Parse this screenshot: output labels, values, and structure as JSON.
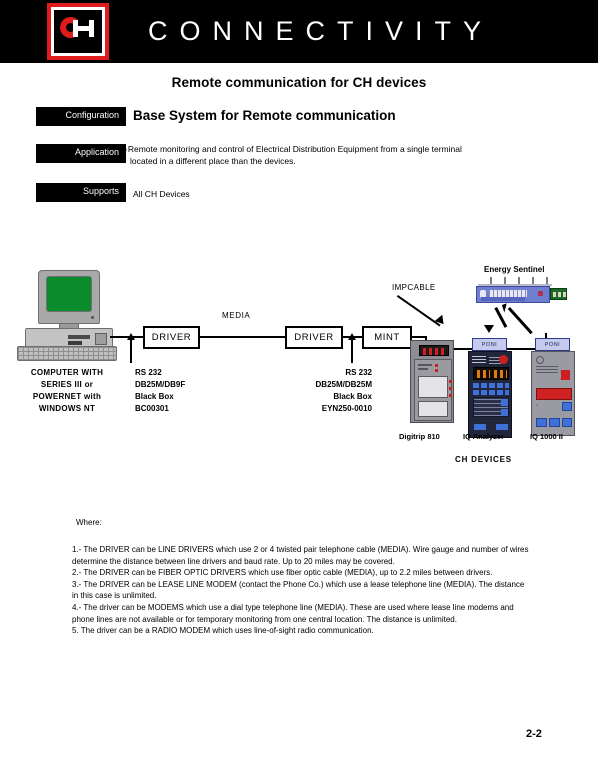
{
  "header": {
    "brand_title": "CONNECTIVITY",
    "logo_name": "ch-logo",
    "bg_color": "#000000",
    "logo_color": "#e01b1b"
  },
  "page_title": "Remote  communication for CH devices",
  "spec_rows": {
    "configuration_tag": "Configuration",
    "configuration_value": "Base System for Remote communication",
    "application_tag": "Application",
    "application_bullet_line1": "Remote monitoring and control of Electrical Distribution Equipment from a single terminal",
    "application_bullet_line2": "located in a different place than the devices.",
    "supports_tag": "Supports",
    "supports_value": "All CH Devices"
  },
  "diagram": {
    "computer_label_line1": "COMPUTER WITH",
    "computer_label_line2": "SERIES III or",
    "computer_label_line3": "POWERNET with",
    "computer_label_line4": "WINDOWS NT",
    "driver1_label": "DRIVER",
    "driver2_label": "DRIVER",
    "mint_label": "MINT",
    "media_label": "MEDIA",
    "impcable_label": "IMPCABLE",
    "energy_sentinel_label": "Energy Sentinel",
    "cable1_line1": "RS 232",
    "cable1_line2": "DB25M/DB9F",
    "cable1_line3": "Black Box",
    "cable1_line4": "BC00301",
    "cable2_line1": "RS 232",
    "cable2_line2": "DB25M/DB25M",
    "cable2_line3": "Black Box",
    "cable2_line4": "EYN250-0010",
    "poni_label": "PONI",
    "devices": [
      {
        "name": "Digitrip 810"
      },
      {
        "name": "IQ Analyzer"
      },
      {
        "name": "IQ 1000 II"
      }
    ],
    "devices_group_label": "CH  DEVICES"
  },
  "notes": {
    "heading": "Where:",
    "items": [
      "1.- The DRIVER can be LINE DRIVERS which use 2 or 4 twisted pair telephone cable (MEDIA). Wire gauge and number of wires determine the distance between line drivers and baud rate. Up to 20 miles may be covered.",
      "2.- The DRIVER can be FIBER OPTIC DRIVERS which use fiber optic cable (MEDIA), up to 2.2 miles between drivers.",
      "3.- The DRIVER can be LEASE LINE MODEM (contact  the Phone Co.) which use a lease telephone line (MEDIA). The distance in this case is unlimited.",
      "4.- The driver can be MODEMS which use a dial type telephone line (MEDIA). These are used where lease line modems and phone lines are not available or for temporary monitoring from one central location. The distance is unlimited.",
      "5. The driver can be a RADIO MODEM which uses line-of-sight radio communication."
    ]
  },
  "page_number": "2-2"
}
